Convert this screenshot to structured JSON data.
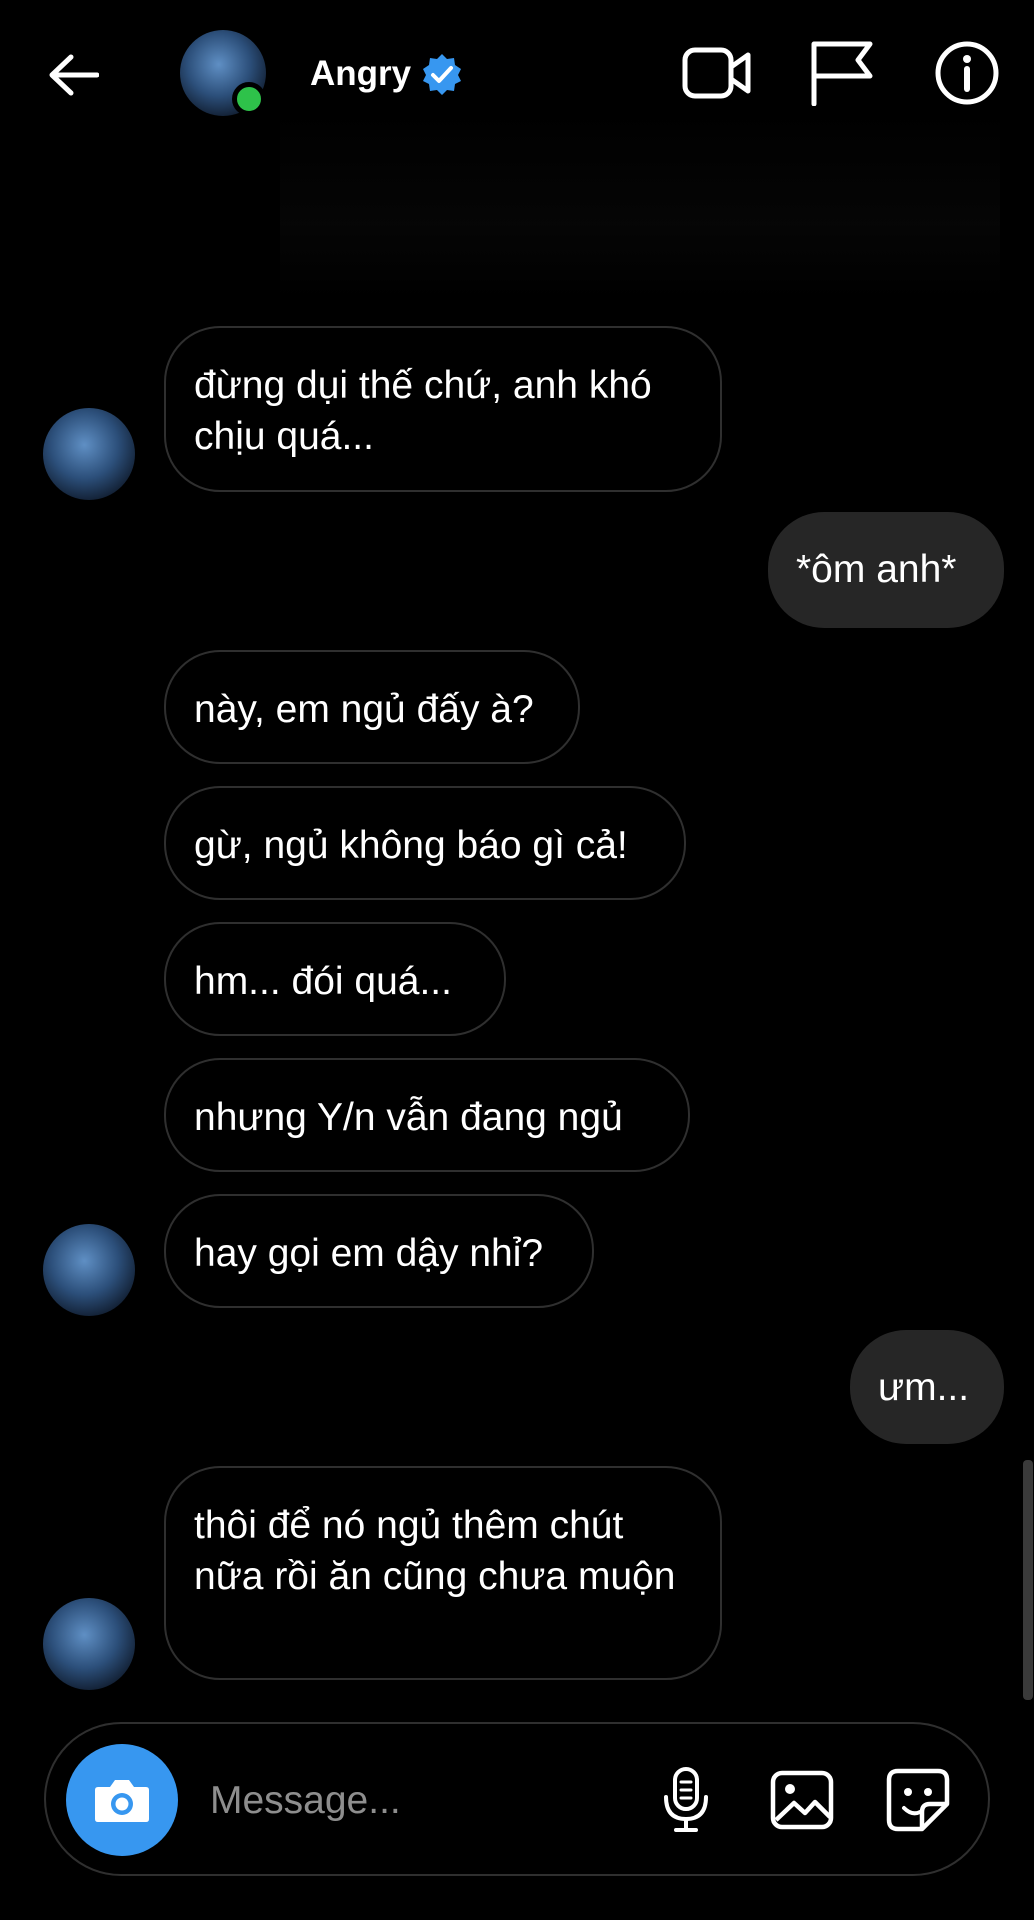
{
  "header": {
    "name": "Angry",
    "icons": [
      "back-arrow-icon",
      "verified-badge-icon",
      "video-call-icon",
      "flag-icon",
      "info-icon"
    ],
    "online": true
  },
  "messages": [
    {
      "side": "in",
      "text": "đừng dụi thế chứ, anh khó chịu quá..."
    },
    {
      "side": "out",
      "text": "*ôm anh*"
    },
    {
      "side": "in",
      "text": "này, em ngủ đấy à?"
    },
    {
      "side": "in",
      "text": "gừ, ngủ không báo gì cả!"
    },
    {
      "side": "in",
      "text": "hm... đói quá..."
    },
    {
      "side": "in",
      "text": "nhưng Y/n vẫn đang ngủ"
    },
    {
      "side": "in",
      "text": "hay gọi em dậy nhỉ?"
    },
    {
      "side": "out",
      "text": "ưm..."
    },
    {
      "side": "in",
      "text": "thôi để nó ngủ thêm chút nữa rồi ăn cũng chưa muộn"
    }
  ],
  "composer": {
    "placeholder": "Message...",
    "icons": [
      "camera-icon",
      "microphone-icon",
      "gallery-icon",
      "sticker-icon"
    ]
  },
  "colors": {
    "background": "#000000",
    "outgoing_bubble": "#262626",
    "incoming_border": "#2f2f2f",
    "accent": "#3797f0",
    "online": "#2ec24a",
    "placeholder": "#8e8e8e"
  }
}
